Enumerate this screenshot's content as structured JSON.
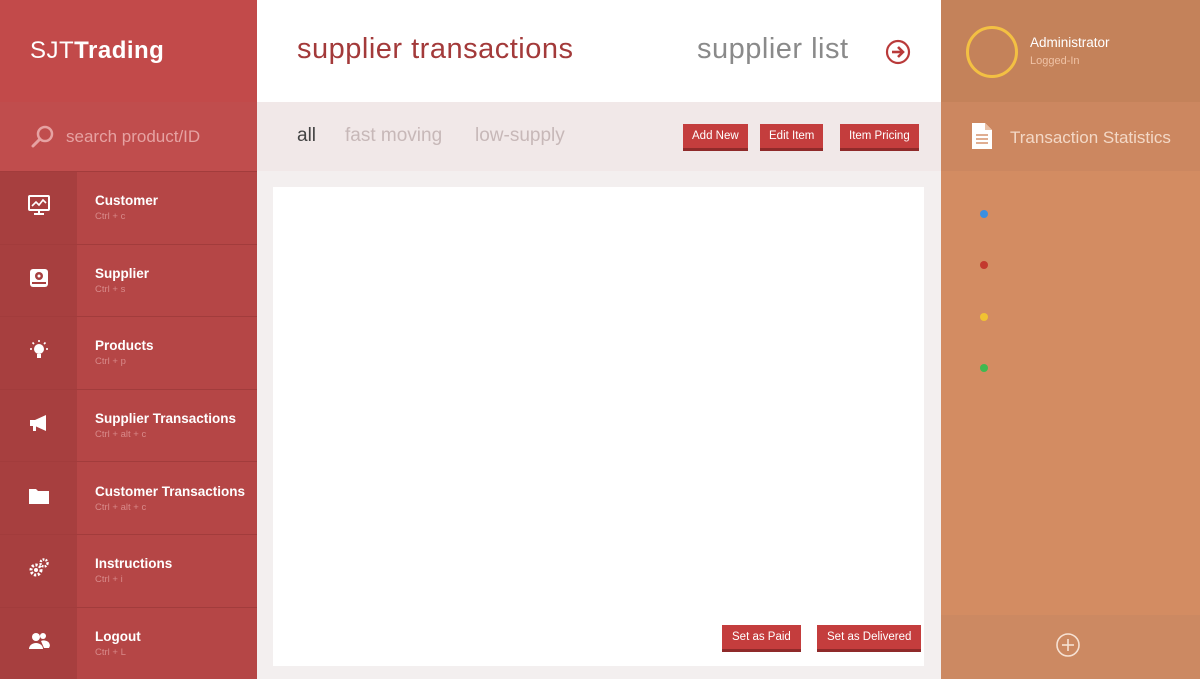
{
  "brand": {
    "part1": "SJT",
    "part2": "Trading"
  },
  "search": {
    "placeholder": "search product/ID"
  },
  "nav": [
    {
      "label": "Customer",
      "shortcut": "Ctrl + c",
      "icon": "chart-monitor-icon"
    },
    {
      "label": "Supplier",
      "shortcut": "Ctrl + s",
      "icon": "drive-icon"
    },
    {
      "label": "Products",
      "shortcut": "Ctrl + p",
      "icon": "lightbulb-icon"
    },
    {
      "label": "Supplier Transactions",
      "shortcut": "Ctrl + alt + c",
      "icon": "megaphone-icon"
    },
    {
      "label": "Customer Transactions",
      "shortcut": "Ctrl + alt + c",
      "icon": "folder-icon"
    },
    {
      "label": "Instructions",
      "shortcut": "Ctrl + i",
      "icon": "gears-icon"
    },
    {
      "label": "Logout",
      "shortcut": "Ctrl + L",
      "icon": "users-icon"
    }
  ],
  "header": {
    "title": "supplier transactions",
    "link": "supplier list"
  },
  "tabs": {
    "all": "all",
    "fast": "fast moving",
    "low": "low-supply"
  },
  "toolbar": {
    "add": "Add New",
    "edit": "Edit Item",
    "pricing": "Item Pricing"
  },
  "actions": {
    "paid": "Set as Paid",
    "delivered": "Set as Delivered"
  },
  "user": {
    "name": "Administrator",
    "status": "Logged-In"
  },
  "stats": {
    "title": "Transaction Statistics"
  },
  "colors": {
    "sidebar": "#b84646",
    "accent": "#c43d3d",
    "right_panel": "#d38c62",
    "dot_blue": "#3b8fe0",
    "dot_red": "#c33a2e",
    "dot_yellow": "#f1c232",
    "dot_green": "#3fb950"
  }
}
